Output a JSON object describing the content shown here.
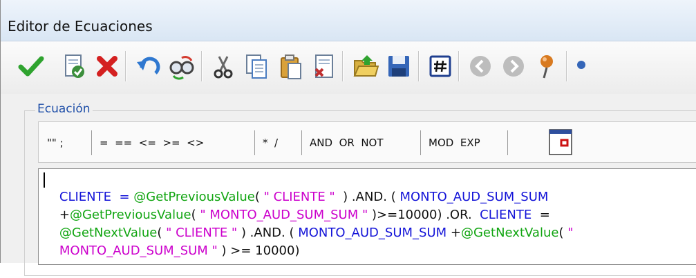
{
  "window": {
    "title": "Editor de Ecuaciones"
  },
  "toolbar": {
    "buttons": [
      {
        "name": "accept-icon",
        "color": "#2fa32f"
      },
      {
        "name": "validate-document-icon",
        "color": "#3c8f3c"
      },
      {
        "name": "cancel-icon",
        "color": "#d42020"
      },
      {
        "name": "undo-icon",
        "color": "#2f78d0"
      },
      {
        "name": "find-replace-icon",
        "color": "#555555"
      },
      {
        "name": "cut-icon",
        "color": "#444444"
      },
      {
        "name": "copy-icon",
        "color": "#4a7cc0"
      },
      {
        "name": "paste-icon",
        "color": "#d9a13a"
      },
      {
        "name": "delete-document-icon",
        "color": "#c03030"
      },
      {
        "name": "open-folder-icon",
        "color": "#d8b040"
      },
      {
        "name": "save-icon",
        "color": "#3566b8"
      },
      {
        "name": "numeric-format-icon",
        "color": "#1f3f8f"
      },
      {
        "name": "back-icon",
        "color": "#bdbdbd"
      },
      {
        "name": "forward-icon",
        "color": "#bdbdbd"
      },
      {
        "name": "pin-icon",
        "color": "#d87a20"
      }
    ]
  },
  "equation_group": {
    "label": "Ecuación",
    "operators": [
      {
        "name": "op-quotes-semicolon",
        "text": "\"\" ;"
      },
      {
        "name": "op-comparison",
        "text": "=  ==  <=  >=  <>"
      },
      {
        "name": "op-arithmetic",
        "text": "*  /"
      },
      {
        "name": "op-logical",
        "text": "AND  OR  NOT"
      },
      {
        "name": "op-math",
        "text": "MOD  EXP"
      }
    ]
  },
  "code": {
    "line1": {
      "a": "CLIENTE  = ",
      "b": "@GetPreviousValue",
      "c": "( ",
      "d": "\" CLIENTE \"",
      "e": "  ) .AND. ( ",
      "f": "MONTO_AUD_SUM_SUM"
    },
    "line2": {
      "a": "+",
      "b": "@GetPreviousValue",
      "c": "( ",
      "d": "\" MONTO_AUD_SUM_SUM \"",
      "e": " )>=10000) .OR.  ",
      "f": "CLIENTE",
      "g": "  ="
    },
    "line3": {
      "a": "@GetNextValue",
      "b": "( ",
      "c": "\" CLIENTE \"",
      "d": " ) .AND. ( ",
      "e": "MONTO_AUD_SUM_SUM",
      "f": " +",
      "g": "@GetNextValue",
      "h": "( ",
      "i": "\""
    },
    "line4": {
      "a": "MONTO_AUD_SUM_SUM \"",
      "b": " ) >= 10000)"
    }
  }
}
